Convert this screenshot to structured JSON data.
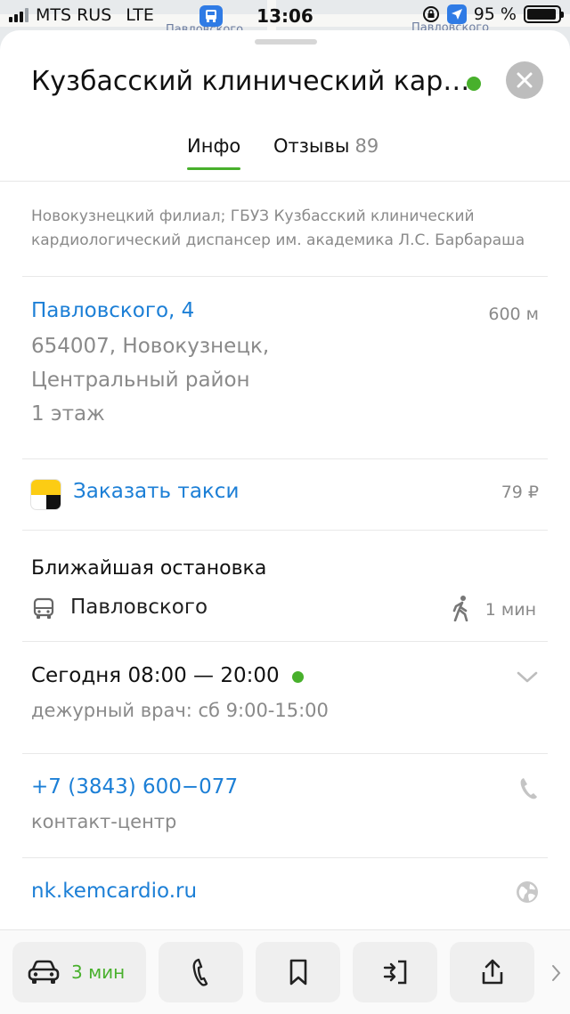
{
  "status_bar": {
    "carrier": "MTS RUS",
    "network": "LTE",
    "time": "13:06",
    "battery": "95 %",
    "battery_level": 0.95,
    "signal_bars": 3
  },
  "map": {
    "street_left": "Павловского",
    "street_right": "Павловского"
  },
  "card": {
    "title": "Кузбасский клинический кар…",
    "open_status_color": "#48b02c",
    "close_icon": "close-icon"
  },
  "tabs": [
    {
      "label": "Инфо",
      "active": true
    },
    {
      "label": "Отзывы",
      "count": "89",
      "active": false
    }
  ],
  "description": "Новокузнецкий филиал; ГБУЗ Кузбасский клинический кардиологический диспансер им. академика Л.С. Барбараша",
  "address": {
    "street": "Павловского, 4",
    "distance": "600 м",
    "line1": "654007, Новокузнецк,",
    "line2": "Центральный район",
    "line3": "1 этаж"
  },
  "taxi": {
    "label": "Заказать такси",
    "price": "79 ₽"
  },
  "stop": {
    "heading": "Ближайшая остановка",
    "name": "Павловского",
    "walk_time": "1 мин"
  },
  "hours": {
    "today": "Сегодня 08:00 — 20:00",
    "note": "дежурный врач: сб 9:00-15:00"
  },
  "contact": {
    "phone": "+7 (3843) 600−077",
    "phone_label": "контакт-центр",
    "website": "nk.kemcardio.ru"
  },
  "actions": {
    "route_time": "3 мин"
  },
  "colors": {
    "accent_green": "#48b02c",
    "link_blue": "#1c7fd6",
    "muted": "#8a8a8a"
  }
}
